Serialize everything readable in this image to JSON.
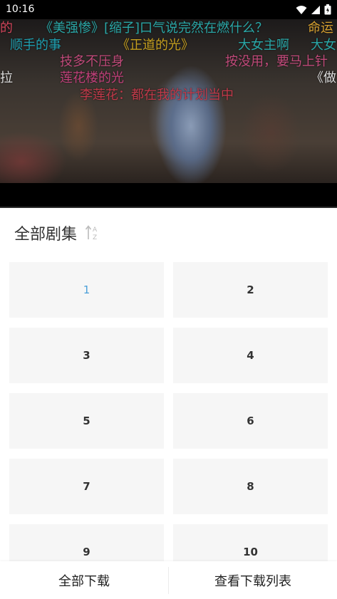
{
  "status_bar": {
    "time": "10:16",
    "icons": [
      "wifi-icon",
      "signal-icon",
      "battery-icon"
    ]
  },
  "video": {
    "danmaku": [
      {
        "text": "的",
        "color": "#d0455a"
      },
      {
        "text": "《美强惨》[缩子]口气说完然在燃什么？",
        "color": "#2aa7a7"
      },
      {
        "text": "命运",
        "color": "#d6a030"
      },
      {
        "text": "顺手的事",
        "color": "#1f9fb0"
      },
      {
        "text": "《正道的光》",
        "color": "#c6a020"
      },
      {
        "text": "大女主啊",
        "color": "#2aa7a7"
      },
      {
        "text": "大女",
        "color": "#2aa7a7"
      },
      {
        "text": "技多不压身",
        "color": "#c04a7a"
      },
      {
        "text": "按没用，要马上针",
        "color": "#c04a7a"
      },
      {
        "text": "拉",
        "color": "#dddddd"
      },
      {
        "text": "莲花楼的光",
        "color": "#c0407a"
      },
      {
        "text": "《做",
        "color": "#dddddd"
      },
      {
        "text": "李莲花：都在我的计划当中",
        "color": "#c03a4a"
      }
    ]
  },
  "panel": {
    "title": "全部剧集",
    "sort_icon": "sort-az-icon",
    "episodes": [
      "1",
      "2",
      "3",
      "4",
      "5",
      "6",
      "7",
      "8",
      "9",
      "10"
    ],
    "active_episode": "1",
    "active_color": "#4a9fd8"
  },
  "bottom_bar": {
    "download_all": "全部下载",
    "view_downloads": "查看下载列表"
  }
}
